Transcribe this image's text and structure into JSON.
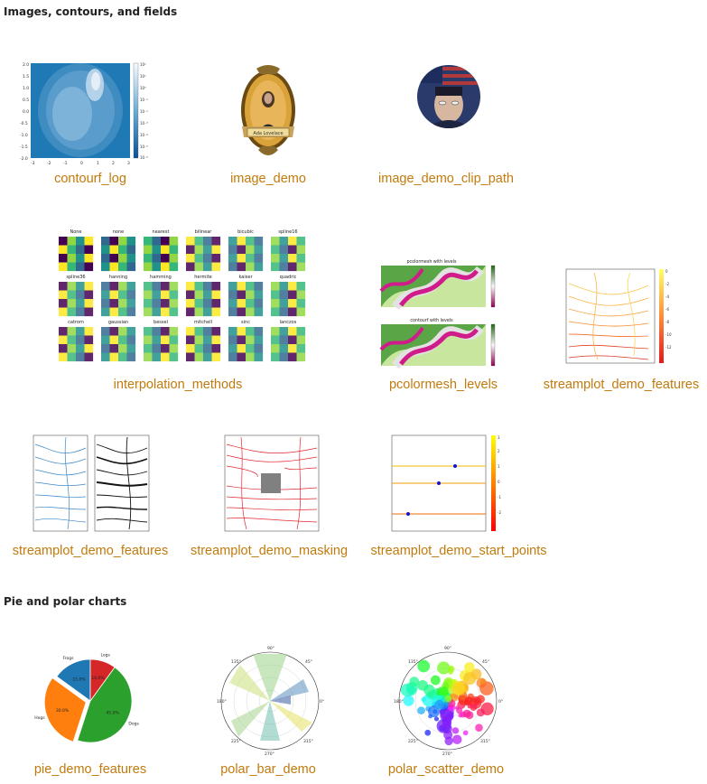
{
  "sections": {
    "images": "Images, contours, and fields",
    "pie": "Pie and polar charts"
  },
  "captions": {
    "contourf_log": "contourf_log",
    "image_demo": "image_demo",
    "image_demo_clip_path": "image_demo_clip_path",
    "interpolation_methods": "interpolation_methods",
    "pcolormesh_levels": "pcolormesh_levels",
    "streamplot_demo_features_a": "streamplot_demo_features",
    "streamplot_demo_features_b": "streamplot_demo_features",
    "streamplot_demo_masking": "streamplot_demo_masking",
    "streamplot_demo_start_points": "streamplot_demo_start_points",
    "pie_demo_features": "pie_demo_features",
    "polar_bar_demo": "polar_bar_demo",
    "polar_scatter_demo": "polar_scatter_demo"
  },
  "interp_labels": [
    "None",
    "none",
    "nearest",
    "bilinear",
    "bicubic",
    "spline16",
    "spline36",
    "hanning",
    "hamming",
    "hermite",
    "kaiser",
    "quadric",
    "catrom",
    "gaussian",
    "bessel",
    "mitchell",
    "sinc",
    "lanczos"
  ],
  "pcolormesh_titles": [
    "pcolormesh with levels",
    "contourf with levels"
  ],
  "image_demo_banner": "Ada Lovelace",
  "pie": {
    "labels": [
      "Frogs",
      "Hogs",
      "Dogs",
      "Logs"
    ],
    "pcts": [
      "15.0%",
      "30.0%",
      "45.0%",
      "10.0%"
    ],
    "colors": [
      "#1f77b4",
      "#ff7f0e",
      "#2ca02c",
      "#d62728"
    ],
    "values": [
      15,
      30,
      45,
      10
    ]
  },
  "polar_angle_labels": [
    "0°",
    "45°",
    "90°",
    "135°",
    "180°",
    "225°",
    "270°",
    "315°"
  ]
}
